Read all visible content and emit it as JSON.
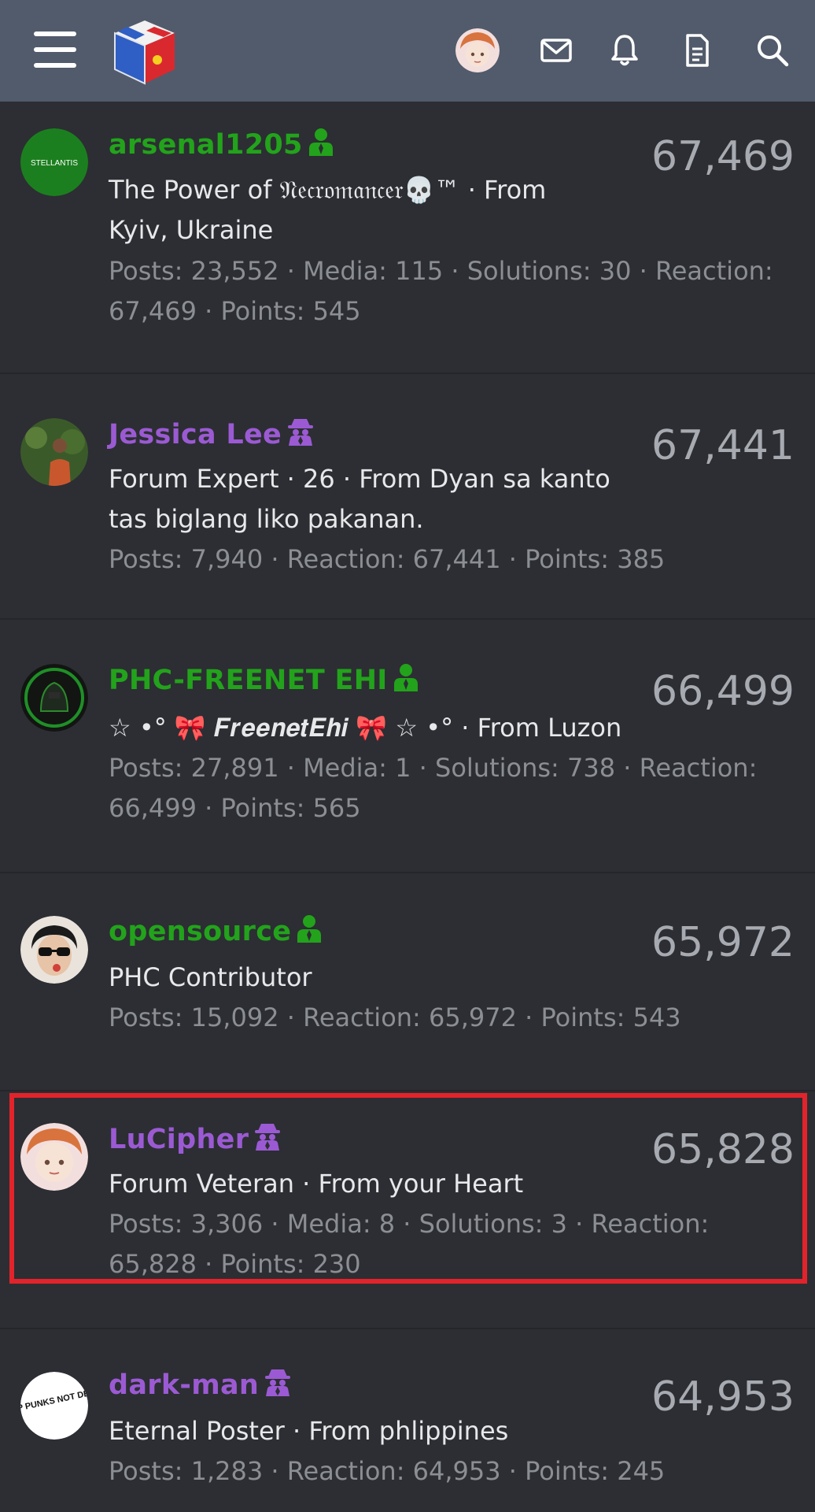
{
  "header": {
    "menu_icon": "hamburger-icon",
    "logo_icon": "cube-logo",
    "avatar_icon": "user-avatar",
    "icons": [
      "mail-icon",
      "bell-icon",
      "document-icon",
      "search-icon"
    ]
  },
  "members": [
    {
      "name": "arsenal1205",
      "name_color": "#22a31b",
      "badge_icon": "user-badge-icon",
      "score": "67,469",
      "title_line": "The Power of 𝔑𝔢𝔠𝔯𝔬𝔪𝔞𝔫𝔠𝔢𝔯💀™ · From Kyiv, Ukraine",
      "stats_line": "Posts: 23,552 · Media: 115 · Solutions: 30 · Reaction: 67,469 · Points: 545",
      "avatar_text": "STELLANTIS"
    },
    {
      "name": "Jessica Lee",
      "name_color": "#9b5ad3",
      "badge_icon": "spy-badge-icon",
      "score": "67,441",
      "title_line": "Forum Expert · 26 · From Dyan sa kanto tas biglang liko pakanan.",
      "stats_line": "Posts: 7,940 · Reaction: 67,441 · Points: 385"
    },
    {
      "name": "PHC-FREENET EHI",
      "name_color": "#22a31b",
      "badge_icon": "user-badge-icon",
      "score": "66,499",
      "title_line": "☆ •° 🎀 𝑭𝒓𝒆𝒆𝒏𝒆𝒕𝑬𝒉𝒊 🎀 ☆ •° · From Luzon",
      "stats_line": "Posts: 27,891 · Media: 1 · Solutions: 738 · Reaction: 66,499 · Points: 565"
    },
    {
      "name": "opensource",
      "name_color": "#22a31b",
      "badge_icon": "user-badge-icon",
      "score": "65,972",
      "title_line": "PHC Contributor",
      "stats_line": "Posts: 15,092 · Reaction: 65,972 · Points: 543"
    },
    {
      "name": "LuCipher",
      "name_color": "#9b5ad3",
      "badge_icon": "spy-badge-icon",
      "score": "65,828",
      "title_line": "Forum Veteran · From your Heart",
      "stats_line": "Posts: 3,306 · Media: 8 · Solutions: 3 · Reaction: 65,828 · Points: 230"
    },
    {
      "name": "dark-man",
      "name_color": "#9b5ad3",
      "badge_icon": "spy-badge-icon",
      "score": "64,953",
      "title_line": "Eternal Poster · From phlippines",
      "stats_line": "Posts: 1,283 · Reaction: 64,953 · Points: 245",
      "avatar_text": "POP PUNKS NOT DEAD"
    }
  ],
  "colors": {
    "background": "#2c2e33",
    "header": "#525b6b",
    "highlight": "#e3232b"
  }
}
